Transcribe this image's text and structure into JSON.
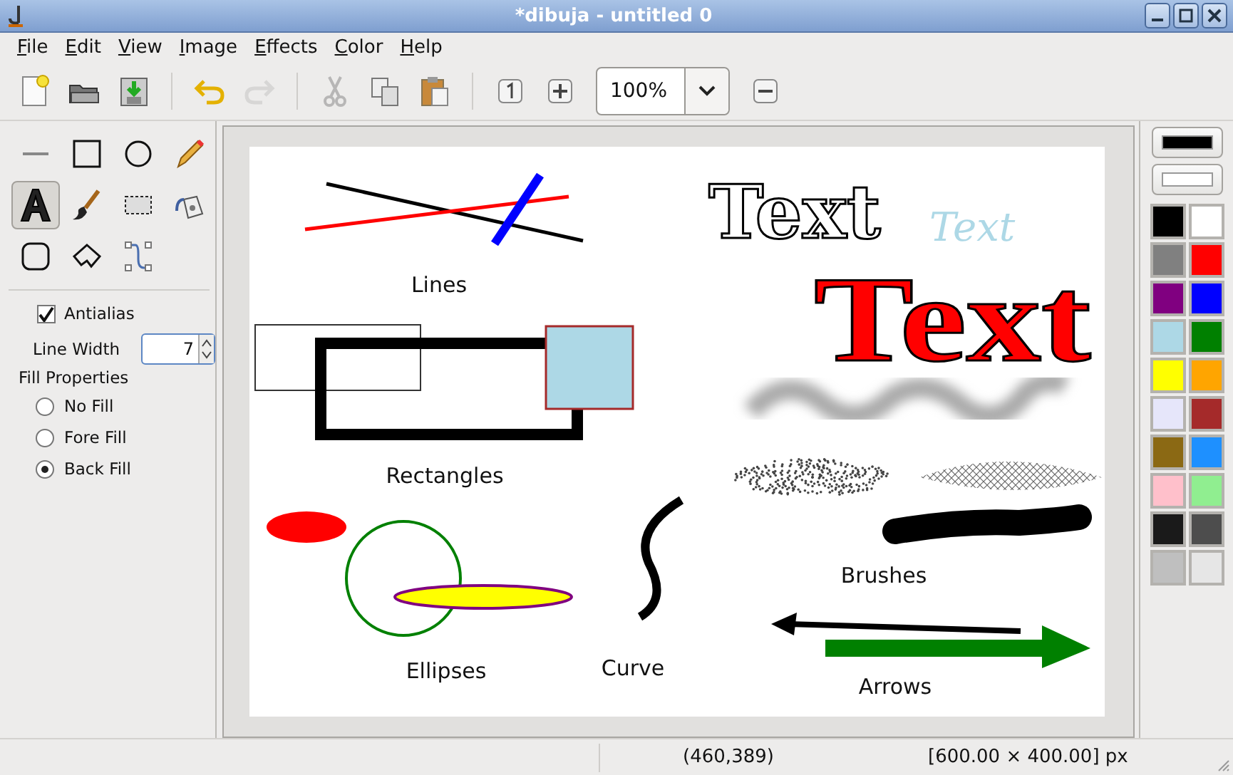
{
  "window": {
    "title": "*dibuja - untitled 0"
  },
  "menu": [
    "File",
    "Edit",
    "View",
    "Image",
    "Effects",
    "Color",
    "Help"
  ],
  "toolbar": {
    "groups": [
      [
        {
          "kind": "new",
          "disabled": false
        },
        {
          "kind": "open",
          "disabled": false
        },
        {
          "kind": "save",
          "disabled": false
        }
      ],
      [
        {
          "kind": "undo",
          "disabled": false
        },
        {
          "kind": "redo",
          "disabled": true
        }
      ],
      [
        {
          "kind": "cut",
          "disabled": true
        },
        {
          "kind": "copy",
          "disabled": false
        },
        {
          "kind": "paste",
          "disabled": false
        }
      ],
      [
        {
          "kind": "zoom_original",
          "disabled": false
        },
        {
          "kind": "zoom_in",
          "disabled": false
        },
        {
          "kind": "zoom_combo",
          "value": "100%"
        },
        {
          "kind": "zoom_out",
          "disabled": false
        }
      ]
    ]
  },
  "tools": [
    {
      "kind": "line",
      "selected": false
    },
    {
      "kind": "rectangle",
      "selected": false
    },
    {
      "kind": "ellipse",
      "selected": false
    },
    {
      "kind": "pencil",
      "selected": false
    },
    {
      "kind": "text",
      "selected": true
    },
    {
      "kind": "brush",
      "selected": false
    },
    {
      "kind": "select",
      "selected": false
    },
    {
      "kind": "fill",
      "selected": false
    },
    {
      "kind": "rounded_rectangle",
      "selected": false
    },
    {
      "kind": "polygon",
      "selected": false
    },
    {
      "kind": "curve",
      "selected": false
    }
  ],
  "options": {
    "antialias": {
      "label": "Antialias",
      "checked": true
    },
    "line_width": {
      "label": "Line Width",
      "value": "7"
    },
    "fill_properties": {
      "label": "Fill Properties",
      "options": [
        {
          "label": "No Fill",
          "selected": false
        },
        {
          "label": "Fore Fill",
          "selected": false
        },
        {
          "label": "Back Fill",
          "selected": true
        }
      ]
    }
  },
  "canvas": {
    "texts": [
      {
        "kind": "outline",
        "text": "Text"
      },
      {
        "kind": "italic",
        "text": "Text"
      },
      {
        "kind": "lines",
        "text": "Lines"
      },
      {
        "kind": "big_red",
        "text": "Text"
      },
      {
        "kind": "rectangles",
        "text": "Rectangles"
      },
      {
        "kind": "brushes",
        "text": "Brushes"
      },
      {
        "kind": "ellipses",
        "text": "Ellipses"
      },
      {
        "kind": "curve",
        "text": "Curve"
      },
      {
        "kind": "arrows",
        "text": "Arrows"
      }
    ]
  },
  "palette": {
    "foreground": {
      "color": "#000000"
    },
    "background": {
      "color": "#ffffff"
    },
    "swatches": [
      {
        "color": "#000000"
      },
      {
        "color": "#ffffff"
      },
      {
        "color": "#808080"
      },
      {
        "color": "#ff0000"
      },
      {
        "color": "#800080"
      },
      {
        "color": "#0000ff"
      },
      {
        "color": "#add8e6"
      },
      {
        "color": "#008000"
      },
      {
        "color": "#ffff00"
      },
      {
        "color": "#ffa500"
      },
      {
        "color": "#e6e6fa"
      },
      {
        "color": "#a52a2a"
      },
      {
        "color": "#8b6914"
      },
      {
        "color": "#1e90ff"
      },
      {
        "color": "#ffc0cb"
      },
      {
        "color": "#90ee90"
      },
      {
        "color": "#1a1a1a"
      },
      {
        "color": "#4d4d4d"
      },
      {
        "color": "#bfbfbf"
      },
      {
        "color": "#e6e6e6"
      }
    ]
  },
  "status_bar": {
    "coordinates": "(460,389)",
    "size": "[600.00 × 400.00] px"
  }
}
